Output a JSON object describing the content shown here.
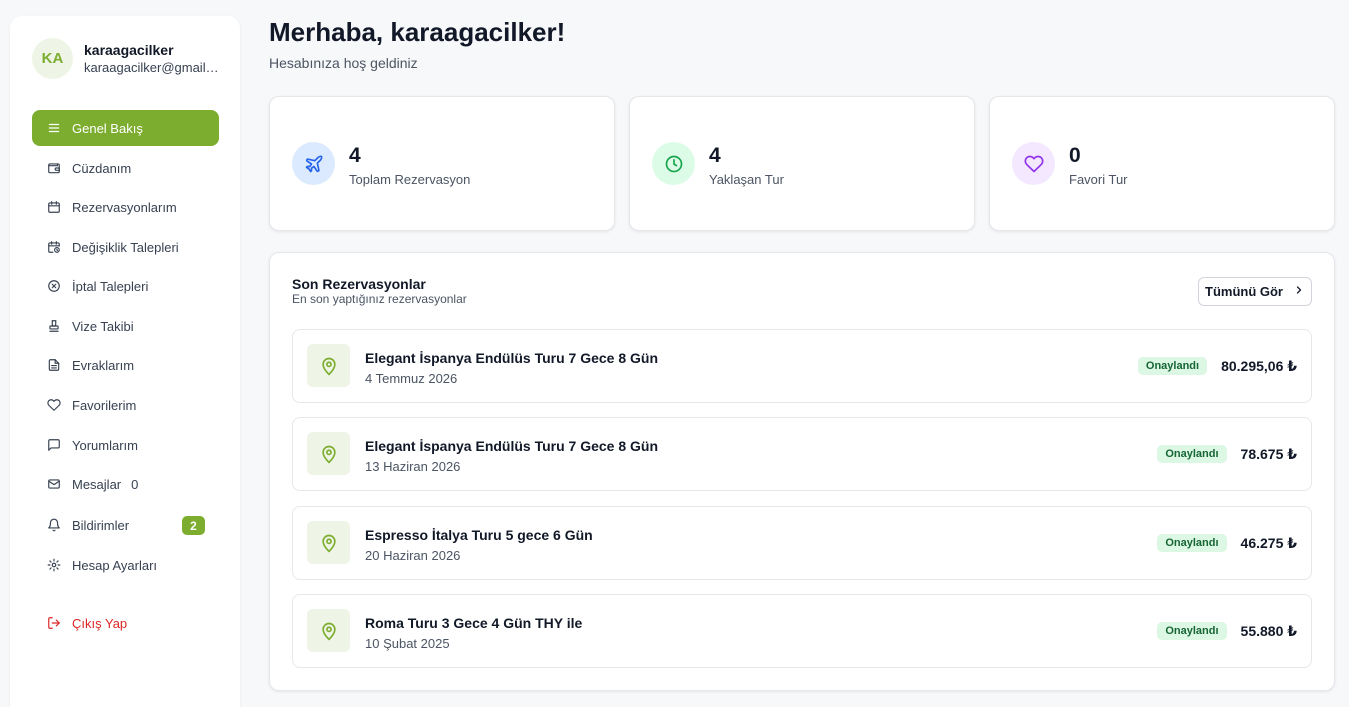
{
  "user": {
    "initials": "KA",
    "name": "karaagacilker",
    "email": "karaagacilker@gmail.c..."
  },
  "sidebar": {
    "items": [
      {
        "label": "Genel Bakış",
        "icon": "menu-icon",
        "active": true
      },
      {
        "label": "Cüzdanım",
        "icon": "wallet-icon"
      },
      {
        "label": "Rezervasyonlarım",
        "icon": "calendar-icon"
      },
      {
        "label": "Değişiklik Talepleri",
        "icon": "calendar-clock-icon"
      },
      {
        "label": "İptal Talepleri",
        "icon": "circle-x-icon"
      },
      {
        "label": "Vize Takibi",
        "icon": "stamp-icon"
      },
      {
        "label": "Evraklarım",
        "icon": "file-text-icon"
      },
      {
        "label": "Favorilerim",
        "icon": "heart-icon"
      },
      {
        "label": "Yorumlarım",
        "icon": "message-square-icon"
      },
      {
        "label": "Mesajlar",
        "icon": "mail-icon",
        "count": "0"
      },
      {
        "label": "Bildirimler",
        "icon": "bell-icon",
        "badge": "2"
      },
      {
        "label": "Hesap Ayarları",
        "icon": "gear-icon"
      },
      {
        "label": "Çıkış Yap",
        "icon": "logout-icon"
      }
    ]
  },
  "header": {
    "greeting": "Merhaba, karaagacilker!",
    "subtitle": "Hesabınıza hoş geldiniz"
  },
  "stats": [
    {
      "value": "4",
      "label": "Toplam Rezervasyon",
      "icon": "plane-icon",
      "color": "#2563eb",
      "bg": "#dbeafe"
    },
    {
      "value": "4",
      "label": "Yaklaşan Tur",
      "icon": "clock-icon",
      "color": "#16a34a",
      "bg": "#dcfce7"
    },
    {
      "value": "0",
      "label": "Favori Tur",
      "icon": "heart-icon",
      "color": "#9333ea",
      "bg": "#f3e8ff"
    }
  ],
  "recent": {
    "title": "Son Rezervasyonlar",
    "subtitle": "En son yaptığınız rezervasyonlar",
    "see_all_label": "Tümünü Gör",
    "items": [
      {
        "title": "Elegant İspanya Endülüs Turu 7 Gece 8 Gün",
        "date": "4 Temmuz 2026",
        "status": "Onaylandı",
        "price": "80.295,06 ₺"
      },
      {
        "title": "Elegant İspanya Endülüs Turu 7 Gece 8 Gün",
        "date": "13 Haziran 2026",
        "status": "Onaylandı",
        "price": "78.675 ₺"
      },
      {
        "title": "Espresso İtalya Turu 5 gece 6 Gün",
        "date": "20 Haziran 2026",
        "status": "Onaylandı",
        "price": "46.275 ₺"
      },
      {
        "title": "Roma Turu 3 Gece 4 Gün THY ile",
        "date": "10 Şubat 2025",
        "status": "Onaylandı",
        "price": "55.880 ₺"
      }
    ]
  },
  "colors": {
    "accent": "#7cad2f",
    "danger": "#dc2626",
    "status_bg": "#dcf7e3",
    "status_text": "#166534"
  }
}
